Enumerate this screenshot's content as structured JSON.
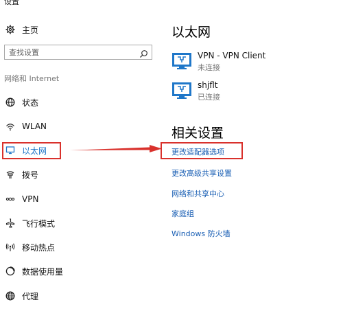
{
  "window": {
    "title": "设置"
  },
  "sidebar": {
    "home_label": "主页",
    "search_placeholder": "查找设置",
    "section_label": "网络和 Internet",
    "items": [
      {
        "label": "状态",
        "icon": "globe-icon"
      },
      {
        "label": "WLAN",
        "icon": "wifi-icon"
      },
      {
        "label": "以太网",
        "icon": "ethernet-icon",
        "selected": true
      },
      {
        "label": "拨号",
        "icon": "dialup-icon"
      },
      {
        "label": "VPN",
        "icon": "vpn-icon"
      },
      {
        "label": "飞行模式",
        "icon": "airplane-icon"
      },
      {
        "label": "移动热点",
        "icon": "hotspot-icon"
      },
      {
        "label": "数据使用量",
        "icon": "data-usage-icon"
      },
      {
        "label": "代理",
        "icon": "proxy-globe-icon"
      }
    ]
  },
  "main": {
    "title": "以太网",
    "connections": [
      {
        "name": "VPN - VPN Client",
        "status": "未连接"
      },
      {
        "name": "shjflt",
        "status": "已连接"
      }
    ],
    "related_title": "相关设置",
    "related_links": [
      {
        "label": "更改适配器选项",
        "highlighted": true
      },
      {
        "label": "更改高级共享设置"
      },
      {
        "label": "网络和共享中心"
      },
      {
        "label": "家庭组"
      },
      {
        "label": "Windows 防火墙"
      }
    ]
  },
  "colors": {
    "accent": "#1a5fb4",
    "annotation": "#d9312c",
    "icon_blue": "#1f77c9"
  }
}
